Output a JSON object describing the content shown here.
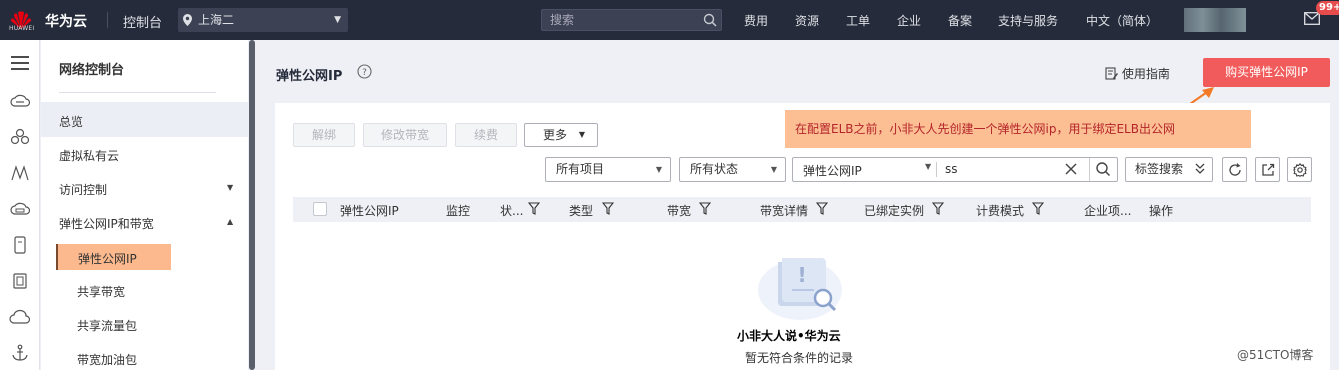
{
  "topbar": {
    "logo_text": "HUAWEI",
    "brand": "华为云",
    "console": "控制台",
    "region": "上海二",
    "search_placeholder": "搜索",
    "nav": [
      "费用",
      "资源",
      "工单",
      "企业",
      "备案",
      "支持与服务",
      "中文（简体）"
    ],
    "badge": "99+"
  },
  "rail_icons": [
    "menu-icon",
    "cloud-server-icon",
    "cluster-icon",
    "network-icon",
    "storage-icon",
    "database-icon",
    "container-icon",
    "cloud-icon",
    "anchor-icon"
  ],
  "sidebar": {
    "title": "网络控制台",
    "items": [
      {
        "label": "总览",
        "expandable": false
      },
      {
        "label": "虚拟私有云",
        "expandable": false
      },
      {
        "label": "访问控制",
        "expandable": true,
        "expanded": false
      },
      {
        "label": "弹性公网IP和带宽",
        "expandable": true,
        "expanded": true
      }
    ],
    "sub_items": [
      "弹性公网IP",
      "共享带宽",
      "共享流量包",
      "带宽加油包"
    ],
    "active": "弹性公网IP"
  },
  "main": {
    "title": "弹性公网IP",
    "guide": "使用指南",
    "buy_button": "购买弹性公网IP",
    "annotation": "在配置ELB之前，小非大人先创建一个弹性公网ip，用于绑定ELB出公网",
    "actions": {
      "unbind": "解绑",
      "modify_bandwidth": "修改带宽",
      "renew": "续费",
      "more": "更多"
    },
    "filters": {
      "project": "所有项目",
      "status": "所有状态",
      "search_type": "弹性公网IP",
      "search_value": "ss",
      "tag_search": "标签搜索"
    },
    "columns": [
      "弹性公网IP",
      "监控",
      "状...",
      "类型",
      "带宽",
      "带宽详情",
      "已绑定实例",
      "计费模式",
      "企业项...",
      "操作"
    ],
    "rows": [],
    "empty_watermark": "小非大人说•华为云",
    "empty_text": "暂无符合条件的记录"
  },
  "watermark": "@51CTO博客",
  "colors": {
    "topbar": "#252b3a",
    "buy_button": "#f25b5b",
    "annotation_bg": "#fcbf93",
    "annotation_text": "#b4242a",
    "active_item": "#fcb98d"
  }
}
